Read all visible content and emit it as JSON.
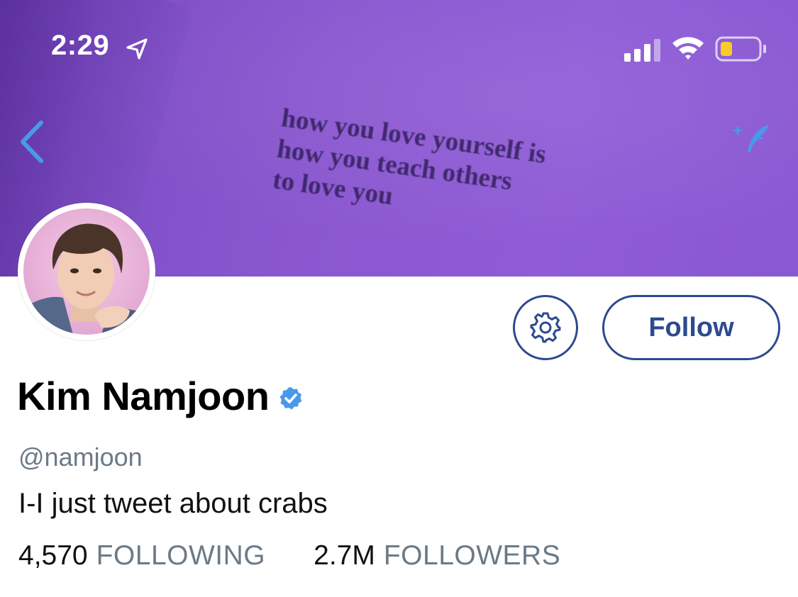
{
  "status_bar": {
    "time": "2:29"
  },
  "banner": {
    "quote_lines": [
      "how you love yourself is",
      "how you teach others",
      "to love you"
    ],
    "color": "#8a57cf"
  },
  "actions": {
    "follow_label": "Follow",
    "accent": "#2d4a8f"
  },
  "profile": {
    "name": "Kim Namjoon",
    "handle": "@namjoon",
    "bio": "I-I just tweet about crabs",
    "following_count": "4,570",
    "following_label": "FOLLOWING",
    "followers_count": "2.7M",
    "followers_label": "FOLLOWERS",
    "verified_color": "#4a99e9"
  },
  "icons": {
    "back": "chevron-left-icon",
    "compose": "sparkle-quill-icon",
    "settings": "gear-icon",
    "verified": "verified-badge-icon"
  }
}
